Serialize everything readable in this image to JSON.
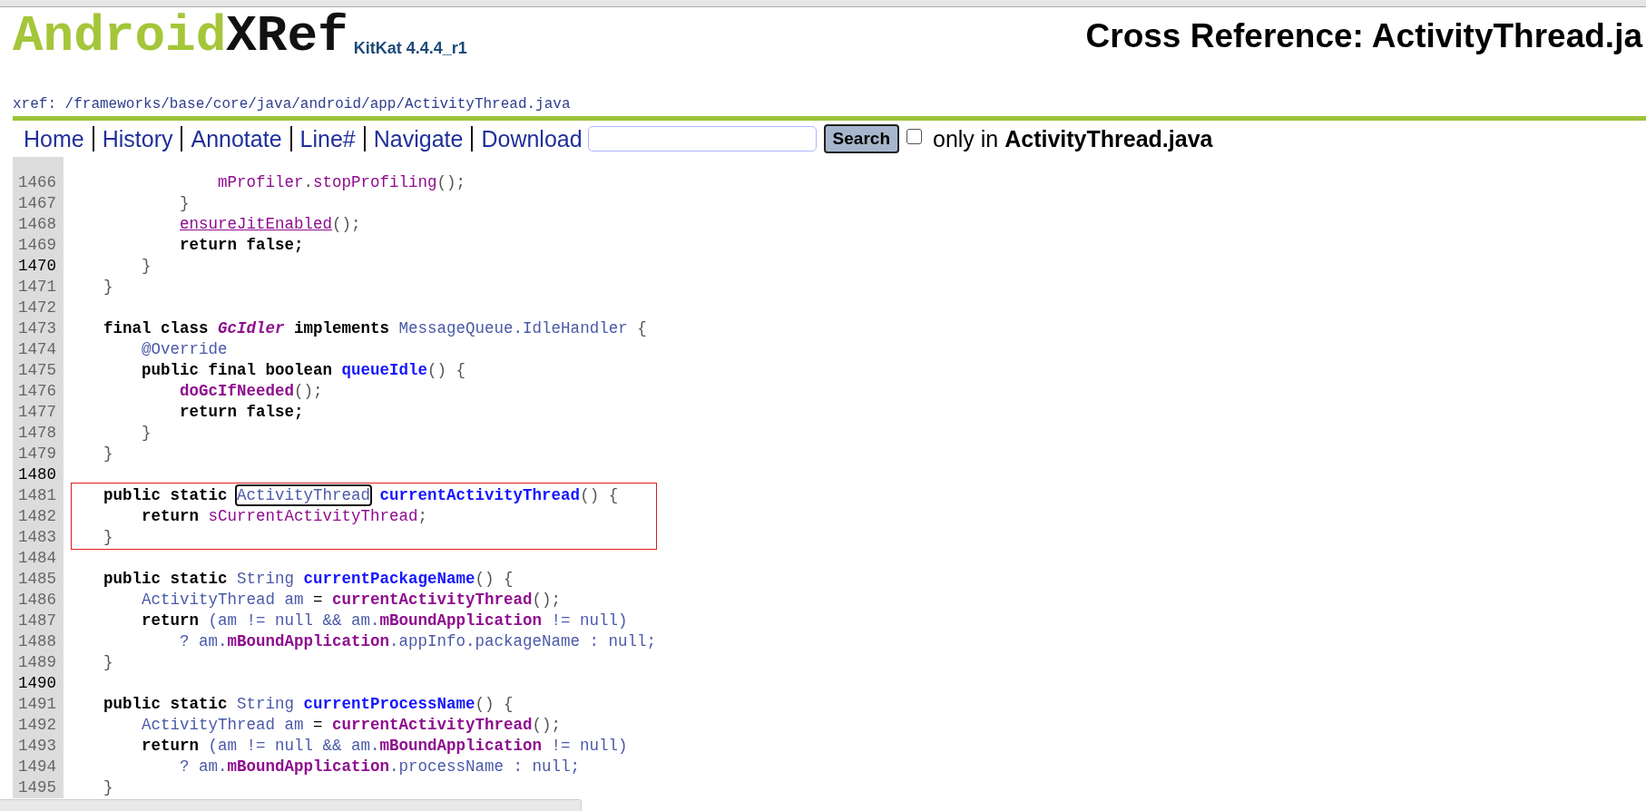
{
  "header": {
    "logo": {
      "part_1": "Android",
      "part_2": "XRef"
    },
    "release": "KitKat 4.4.4_r1",
    "title": "Cross Reference: ActivityThread.ja",
    "path": "xref: /frameworks/base/core/java/android/app/ActivityThread.java"
  },
  "nav": {
    "links": [
      "Home",
      "History",
      "Annotate",
      "Line#",
      "Navigate",
      "Download"
    ],
    "search_button": "Search",
    "only_in": {
      "checked": false,
      "label": "only in **ActivityThread.java**"
    }
  },
  "code_lines": [
    {
      "n": "1466",
      "emph": false,
      "boxed": false,
      "tokens": [
        {
          "kind": "field",
          "text": "                mProfiler"
        },
        {
          "kind": "pun",
          "text": "."
        },
        {
          "kind": "field",
          "text": "stopProfiling"
        },
        {
          "kind": "pun",
          "text": "();"
        }
      ]
    },
    {
      "n": "1467",
      "emph": false,
      "boxed": false,
      "tokens": [
        {
          "kind": "pun",
          "text": "            }"
        }
      ]
    },
    {
      "n": "1468",
      "emph": false,
      "boxed": false,
      "tokens": [
        {
          "kind": "link",
          "text": "            ensureJitEnabled"
        },
        {
          "kind": "pun",
          "text": "();"
        }
      ]
    },
    {
      "n": "1469",
      "emph": false,
      "boxed": false,
      "tokens": [
        {
          "kind": "kw",
          "text": "            return false;"
        }
      ]
    },
    {
      "n": "1470",
      "emph": true,
      "boxed": false,
      "tokens": [
        {
          "kind": "pun",
          "text": "        }"
        }
      ]
    },
    {
      "n": "1471",
      "emph": false,
      "boxed": false,
      "tokens": [
        {
          "kind": "pun",
          "text": "    }"
        }
      ]
    },
    {
      "n": "1472",
      "emph": false,
      "boxed": false
    },
    {
      "n": "1473",
      "emph": false,
      "boxed": false,
      "tokens": [
        {
          "kind": "kw",
          "text": "    final class "
        },
        {
          "kind": "italic",
          "text": "GcIdler"
        },
        {
          "kind": "kw",
          "text": " implements "
        },
        {
          "kind": "type",
          "text": "MessageQueue.IdleHandler"
        },
        {
          "kind": "pun",
          "text": " {"
        }
      ]
    },
    {
      "n": "1474",
      "emph": false,
      "boxed": false,
      "tokens": [
        {
          "kind": "type",
          "text": "        @Override"
        }
      ]
    },
    {
      "n": "1475",
      "emph": false,
      "boxed": false,
      "tokens": [
        {
          "kind": "kw",
          "text": "        public final boolean "
        },
        {
          "kind": "method",
          "text": "queueIdle"
        },
        {
          "kind": "pun",
          "text": "() {"
        }
      ]
    },
    {
      "n": "1476",
      "emph": false,
      "boxed": false,
      "tokens": [
        {
          "kind": "call",
          "text": "            doGcIfNeeded"
        },
        {
          "kind": "pun",
          "text": "();"
        }
      ]
    },
    {
      "n": "1477",
      "emph": false,
      "boxed": false,
      "tokens": [
        {
          "kind": "kw",
          "text": "            return false;"
        }
      ]
    },
    {
      "n": "1478",
      "emph": false,
      "boxed": false,
      "tokens": [
        {
          "kind": "pun",
          "text": "        }"
        }
      ]
    },
    {
      "n": "1479",
      "emph": false,
      "boxed": false,
      "tokens": [
        {
          "kind": "pun",
          "text": "    }"
        }
      ]
    },
    {
      "n": "1480",
      "emph": true,
      "boxed": false
    },
    {
      "n": "1481",
      "emph": false,
      "boxed": true,
      "tokens": [
        {
          "kind": "kw",
          "text": "    public static "
        },
        {
          "kind": "focus",
          "text": "ActivityThread"
        },
        {
          "kind": "method",
          "text": " currentActivityThread"
        },
        {
          "kind": "pun",
          "text": "() {"
        }
      ]
    },
    {
      "n": "1482",
      "emph": false,
      "boxed": true,
      "tokens": [
        {
          "kind": "kw",
          "text": "        return "
        },
        {
          "kind": "field",
          "text": "sCurrentActivityThread"
        },
        {
          "kind": "pun",
          "text": ";"
        }
      ]
    },
    {
      "n": "1483",
      "emph": false,
      "boxed": true,
      "tokens": [
        {
          "kind": "pun",
          "text": "    }"
        }
      ]
    },
    {
      "n": "1484",
      "emph": false,
      "boxed": false
    },
    {
      "n": "1485",
      "emph": false,
      "boxed": false,
      "tokens": [
        {
          "kind": "kw",
          "text": "    public static "
        },
        {
          "kind": "type",
          "text": "String "
        },
        {
          "kind": "method",
          "text": "currentPackageName"
        },
        {
          "kind": "pun",
          "text": "() {"
        }
      ]
    },
    {
      "n": "1486",
      "emph": false,
      "boxed": false,
      "tokens": [
        {
          "kind": "type",
          "text": "        ActivityThread am"
        },
        {
          "kind": "plain",
          "text": " = "
        },
        {
          "kind": "call",
          "text": "currentActivityThread"
        },
        {
          "kind": "pun",
          "text": "();"
        }
      ]
    },
    {
      "n": "1487",
      "emph": false,
      "boxed": false,
      "tokens": [
        {
          "kind": "kw",
          "text": "        return "
        },
        {
          "kind": "type",
          "text": "(am != null && am."
        },
        {
          "kind": "call",
          "text": "mBoundApplication"
        },
        {
          "kind": "type",
          "text": " != null)"
        }
      ]
    },
    {
      "n": "1488",
      "emph": false,
      "boxed": false,
      "tokens": [
        {
          "kind": "type",
          "text": "            ? am."
        },
        {
          "kind": "call",
          "text": "mBoundApplication"
        },
        {
          "kind": "type",
          "text": ".appInfo.packageName : null;"
        }
      ]
    },
    {
      "n": "1489",
      "emph": false,
      "boxed": false,
      "tokens": [
        {
          "kind": "pun",
          "text": "    }"
        }
      ]
    },
    {
      "n": "1490",
      "emph": true,
      "boxed": false
    },
    {
      "n": "1491",
      "emph": false,
      "boxed": false,
      "tokens": [
        {
          "kind": "kw",
          "text": "    public static "
        },
        {
          "kind": "type",
          "text": "String "
        },
        {
          "kind": "method",
          "text": "currentProcessName"
        },
        {
          "kind": "pun",
          "text": "() {"
        }
      ]
    },
    {
      "n": "1492",
      "emph": false,
      "boxed": false,
      "tokens": [
        {
          "kind": "type",
          "text": "        ActivityThread am"
        },
        {
          "kind": "plain",
          "text": " = "
        },
        {
          "kind": "call",
          "text": "currentActivityThread"
        },
        {
          "kind": "pun",
          "text": "();"
        }
      ]
    },
    {
      "n": "1493",
      "emph": false,
      "boxed": false,
      "tokens": [
        {
          "kind": "kw",
          "text": "        return "
        },
        {
          "kind": "type",
          "text": "(am != null && am."
        },
        {
          "kind": "call",
          "text": "mBoundApplication"
        },
        {
          "kind": "type",
          "text": " != null)"
        }
      ]
    },
    {
      "n": "1494",
      "emph": false,
      "boxed": false,
      "tokens": [
        {
          "kind": "type",
          "text": "            ? am."
        },
        {
          "kind": "call",
          "text": "mBoundApplication"
        },
        {
          "kind": "type",
          "text": ".processName : null;"
        }
      ]
    },
    {
      "n": "1495",
      "emph": false,
      "boxed": false,
      "tokens": [
        {
          "kind": "pun",
          "text": "    }"
        }
      ]
    }
  ]
}
